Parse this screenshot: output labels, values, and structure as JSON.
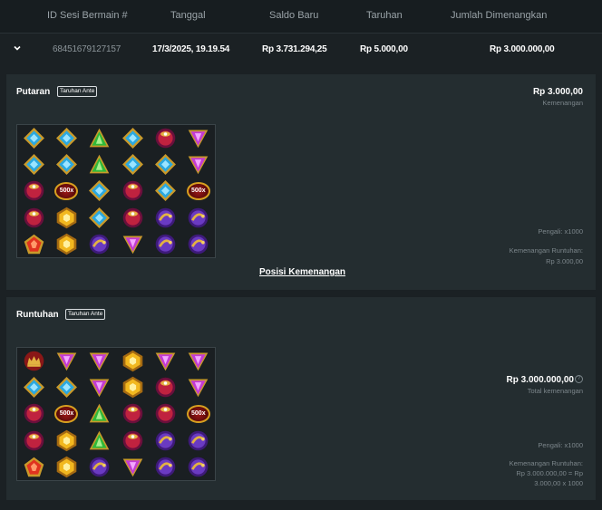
{
  "table": {
    "headers": [
      "ID Sesi Bermain #",
      "Tanggal",
      "Saldo Baru",
      "Taruhan",
      "Jumlah Dimenangkan"
    ],
    "row": {
      "session_id": "68451679127157",
      "date": "17/3/2025, 19.19.54",
      "new_balance": "Rp 3.731.294,25",
      "bet": "Rp 5.000,00",
      "win": "Rp 3.000.000,00"
    }
  },
  "spin": {
    "title": "Putaran",
    "badge": "Taruhan Ante",
    "win_amount": "Rp 3.000,00",
    "win_label": "Kemenangan",
    "multiplier": "Pengali: x1000",
    "cascade_win_label": "Kemenangan Runtuhan:",
    "cascade_win_value": "Rp 3.000,00",
    "win_positions_link": "Posisi Kemenangan",
    "grid": [
      [
        "blue",
        "blue",
        "green",
        "blue",
        "redring",
        "pink"
      ],
      [
        "blue",
        "blue",
        "green",
        "blue",
        "blue",
        "pink"
      ],
      [
        "redring",
        "mult",
        "blue",
        "redring",
        "blue",
        "mult"
      ],
      [
        "redring",
        "gold",
        "blue",
        "redring",
        "purple",
        "purple"
      ],
      [
        "redgem",
        "gold",
        "purple",
        "pink",
        "purple",
        "purple"
      ]
    ]
  },
  "cascade": {
    "title": "Runtuhan",
    "badge": "Taruhan Ante",
    "total_amount": "Rp 3.000.000,00",
    "total_label": "Total kemenangan",
    "multiplier": "Pengali: x1000",
    "cascade_win_label": "Kemenangan Runtuhan:",
    "cascade_win_formula_1": "Rp 3.000.000,00 = Rp",
    "cascade_win_formula_2": "3.000,00 x 1000",
    "grid": [
      [
        "crown",
        "pink",
        "pink",
        "gold",
        "pink",
        "pink"
      ],
      [
        "blue",
        "blue",
        "pink",
        "gold",
        "redring",
        "pink"
      ],
      [
        "redring",
        "mult",
        "green",
        "redring",
        "redring",
        "mult"
      ],
      [
        "redring",
        "gold",
        "green",
        "redring",
        "purple",
        "purple"
      ],
      [
        "redgem",
        "gold",
        "purple",
        "pink",
        "purple",
        "purple"
      ]
    ]
  },
  "multiplier_label": "500x",
  "colors": {
    "bg": "#1b2124",
    "panel": "#242d30",
    "header": "#171d20",
    "muted": "#7c868b"
  }
}
